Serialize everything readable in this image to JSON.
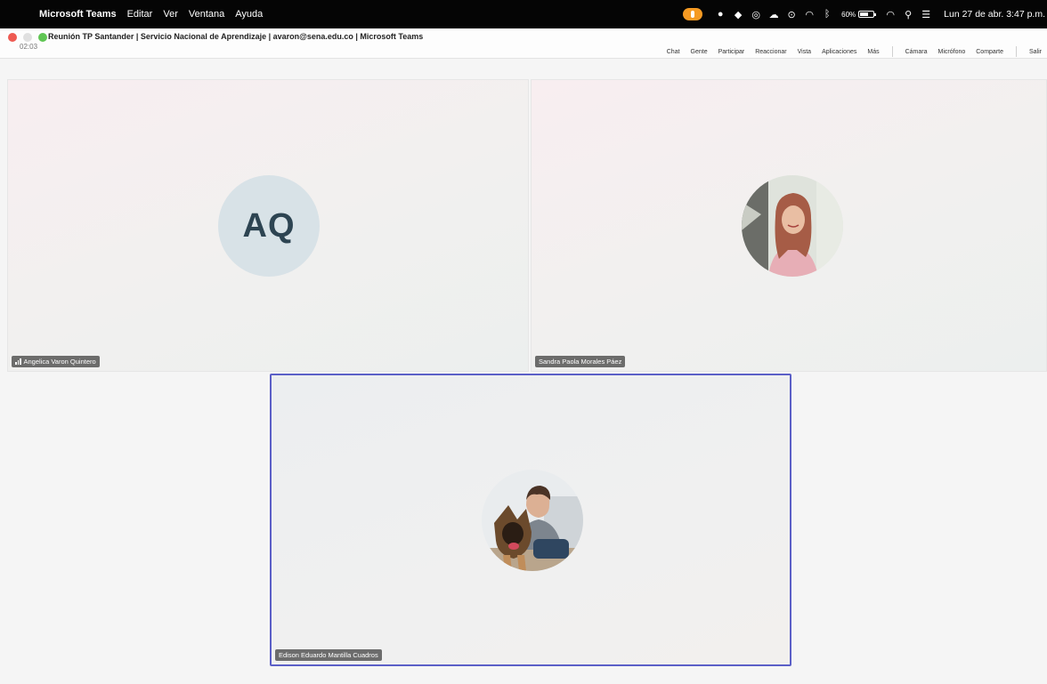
{
  "menubar": {
    "app_name": "Microsoft Teams",
    "menus": [
      "Editar",
      "Ver",
      "Ventana",
      "Ayuda"
    ],
    "battery": "60%",
    "clock": "Lun 27 de abr. 3:47 p.m."
  },
  "window": {
    "title": "Reunión TP Santander | Servicio Nacional de Aprendizaje | avaron@sena.edu.co | Microsoft Teams",
    "meeting_time": "02:03"
  },
  "toolbar": {
    "chat": "Chat",
    "people": "Gente",
    "raise": "Participar",
    "react": "Reaccionar",
    "view": "Vista",
    "apps": "Aplicaciones",
    "more": "Más",
    "camera": "Cámara",
    "mic": "Micrófono",
    "share": "Comparte",
    "leave": "Salir"
  },
  "participants": [
    {
      "name": "Angelica Varon Quintero",
      "initials": "AQ"
    },
    {
      "name": "Sandra Paola Morales Páez"
    },
    {
      "name": "Edison Eduardo Mantilla Cuadros"
    }
  ],
  "colors": {
    "active_speaker_border": "#5b5fc7",
    "initials_avatar_bg": "#d8e2e7",
    "initials_text": "#2d4452",
    "mic_indicator": "#f59a23"
  }
}
